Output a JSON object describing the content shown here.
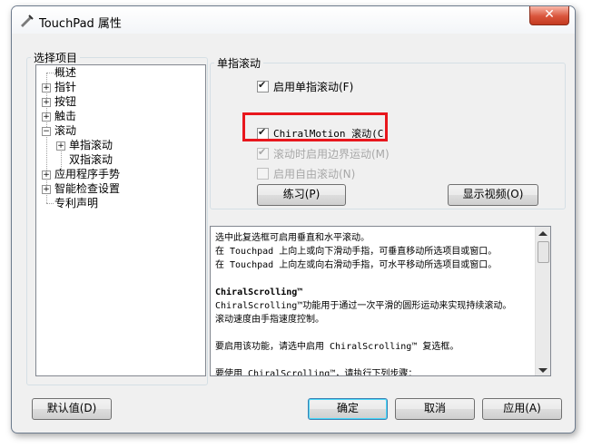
{
  "window": {
    "title": "TouchPad 属性",
    "close_label": "✕"
  },
  "left_group": {
    "legend": "选择项目"
  },
  "tree": {
    "items": [
      {
        "label": "概述",
        "expandable": false
      },
      {
        "label": "指针",
        "expandable": true,
        "expander": "+"
      },
      {
        "label": "按钮",
        "expandable": true,
        "expander": "+"
      },
      {
        "label": "触击",
        "expandable": true,
        "expander": "+"
      },
      {
        "label": "滚动",
        "expandable": true,
        "expander": "−"
      },
      {
        "label": "单指滚动",
        "expandable": true,
        "expander": "+"
      },
      {
        "label": "双指滚动",
        "expandable": false
      },
      {
        "label": "应用程序手势",
        "expandable": true,
        "expander": "+"
      },
      {
        "label": "智能检查设置",
        "expandable": true,
        "expander": "+"
      },
      {
        "label": "专利声明",
        "expandable": false
      }
    ]
  },
  "right_group": {
    "legend": "单指滚动"
  },
  "options": {
    "enable_single_scroll": {
      "label": "启用单指滚动(F)",
      "checked": true,
      "enabled": true
    },
    "chiral_motion": {
      "label": "ChiralMotion 滚动(C)",
      "checked": true,
      "enabled": true
    },
    "edge_motion": {
      "label": "滚动时启用边界运动(M)",
      "checked": true,
      "enabled": false
    },
    "free_scroll": {
      "label": "启用自由滚动(N)",
      "checked": false,
      "enabled": false
    }
  },
  "buttons": {
    "practice": "练习(P)",
    "show_video": "显示视频(O)",
    "defaults": "默认值(D)",
    "ok": "确定",
    "cancel": "取消",
    "apply": "应用(A)"
  },
  "description": {
    "lines": [
      "选中此复选框可启用垂直和水平滚动。",
      "在 Touchpad 上向上或向下滑动手指，可垂直移动所选项目或窗口。",
      "在 Touchpad 上向左或向右滑动手指，可水平移动所选项目或窗口。",
      "",
      "ChiralScrolling™",
      "ChiralScrolling™功能用于通过一次平滑的圆形运动来实现持续滚动。",
      "滚动速度由手指速度控制。",
      "",
      "要启用该功能，请选中启用 ChiralScrolling™ 复选框。",
      "",
      "要使用 ChiralScrolling™，请执行下列步骤："
    ]
  },
  "colors": {
    "highlight": "#e8171d",
    "dialog_bg": "#f0f0f0"
  }
}
